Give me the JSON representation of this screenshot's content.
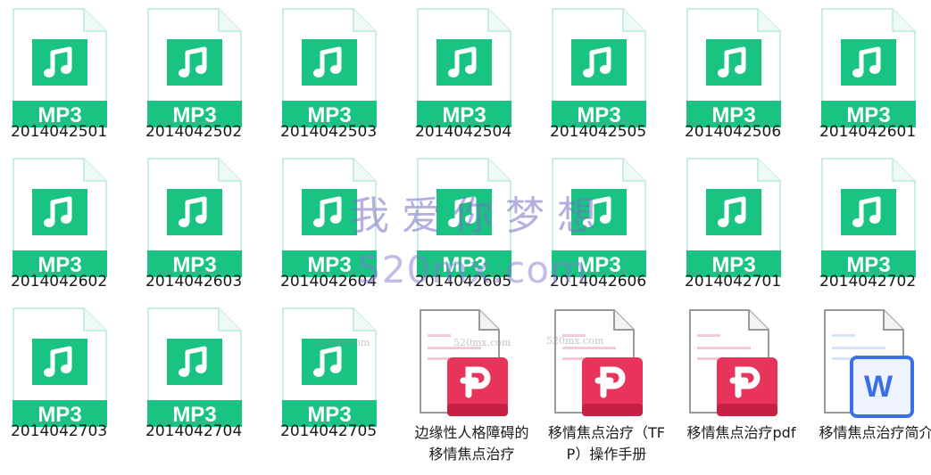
{
  "colors": {
    "mp3_green": "#19c483",
    "mp3_stroke": "#b9ead6",
    "pdf_red": "#e8345a",
    "word_blue": "#3b6fe8",
    "watermark": "#7c6fd0"
  },
  "files": [
    {
      "name": "2014042501",
      "type": "mp3",
      "badge": "MP3",
      "icon": "music-note-icon"
    },
    {
      "name": "2014042502",
      "type": "mp3",
      "badge": "MP3",
      "icon": "music-note-icon"
    },
    {
      "name": "2014042503",
      "type": "mp3",
      "badge": "MP3",
      "icon": "music-note-icon"
    },
    {
      "name": "2014042504",
      "type": "mp3",
      "badge": "MP3",
      "icon": "music-note-icon"
    },
    {
      "name": "2014042505",
      "type": "mp3",
      "badge": "MP3",
      "icon": "music-note-icon"
    },
    {
      "name": "2014042506",
      "type": "mp3",
      "badge": "MP3",
      "icon": "music-note-icon"
    },
    {
      "name": "2014042601",
      "type": "mp3",
      "badge": "MP3",
      "icon": "music-note-icon"
    },
    {
      "name": "2014042602",
      "type": "mp3",
      "badge": "MP3",
      "icon": "music-note-icon"
    },
    {
      "name": "2014042603",
      "type": "mp3",
      "badge": "MP3",
      "icon": "music-note-icon"
    },
    {
      "name": "2014042604",
      "type": "mp3",
      "badge": "MP3",
      "icon": "music-note-icon"
    },
    {
      "name": "2014042605",
      "type": "mp3",
      "badge": "MP3",
      "icon": "music-note-icon"
    },
    {
      "name": "2014042606",
      "type": "mp3",
      "badge": "MP3",
      "icon": "music-note-icon"
    },
    {
      "name": "2014042701",
      "type": "mp3",
      "badge": "MP3",
      "icon": "music-note-icon"
    },
    {
      "name": "2014042702",
      "type": "mp3",
      "badge": "MP3",
      "icon": "music-note-icon"
    },
    {
      "name": "2014042703",
      "type": "mp3",
      "badge": "MP3",
      "icon": "music-note-icon"
    },
    {
      "name": "2014042704",
      "type": "mp3",
      "badge": "MP3",
      "icon": "music-note-icon"
    },
    {
      "name": "2014042705",
      "type": "mp3",
      "badge": "MP3",
      "icon": "music-note-icon"
    },
    {
      "name": "边缘性人格障碍的移情焦点治疗",
      "type": "pdf",
      "icon": "pdf-icon"
    },
    {
      "name": "移情焦点治疗（TFP）操作手册",
      "type": "pdf",
      "icon": "pdf-icon"
    },
    {
      "name": "移情焦点治疗pdf",
      "type": "pdf",
      "icon": "pdf-icon"
    },
    {
      "name": "移情焦点治疗简介",
      "type": "word",
      "badge": "W",
      "icon": "word-doc-icon"
    }
  ],
  "watermark": {
    "title": "我爱你梦想",
    "url": "520mx.com",
    "small": "520mx.com"
  }
}
